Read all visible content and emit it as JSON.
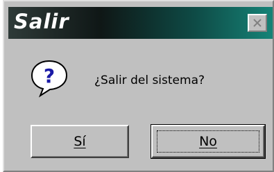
{
  "dialog": {
    "title": "Salir",
    "message": "¿Salir del sistema?",
    "icon": "question-icon",
    "close_icon": "close-icon",
    "buttons": {
      "yes_label": "Sí",
      "no_label": "No"
    },
    "colors": {
      "title_gradient_start": "#0f1716",
      "title_gradient_end": "#168377",
      "face": "#c0c0c0",
      "icon_accent": "#1a1aa6"
    }
  }
}
